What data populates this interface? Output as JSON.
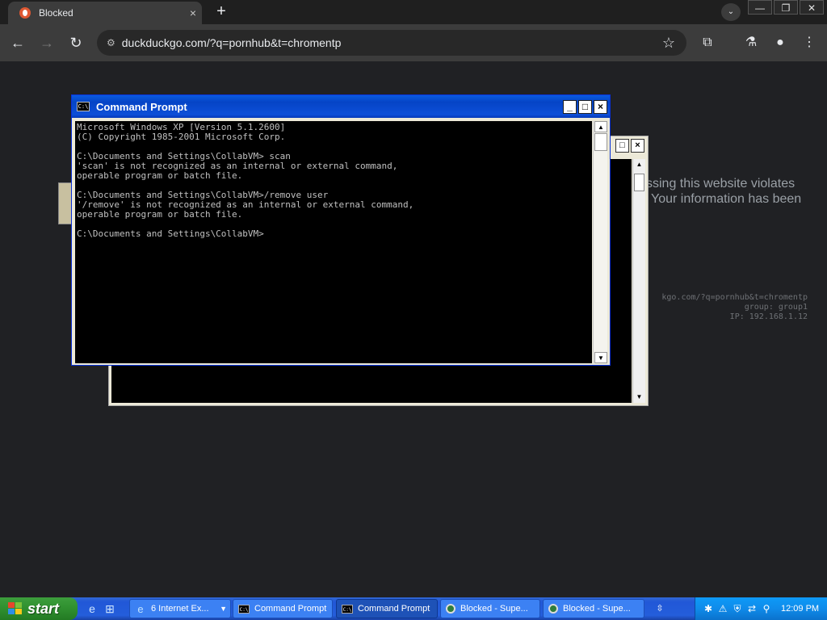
{
  "browser": {
    "tab_title": "Blocked",
    "tab_close": "×",
    "new_tab": "+",
    "tab_search": "⌄",
    "window_controls": [
      "—",
      "❐",
      "✕"
    ],
    "nav": {
      "back": "←",
      "forward": "→",
      "reload": "↻"
    },
    "url": "duckduckgo.com/?q=pornhub&t=chromentp",
    "bookmark": "☆",
    "extensions": "⧉",
    "labs": "⚗",
    "profile": "●",
    "menu": "⋮"
  },
  "page": {
    "blocked_line1": "ssing this website violates",
    "blocked_line2": "Your information has been",
    "meta_line1": "kgo.com/?q=pornhub&t=chromentp",
    "meta_line2": "group: group1",
    "meta_line3": "IP: 192.168.1.12"
  },
  "cmd_window": {
    "title": "Command Prompt",
    "icon": "C:\\",
    "controls": [
      "_",
      "□",
      "×"
    ],
    "console_lines": [
      "Microsoft Windows XP [Version 5.1.2600]",
      "(C) Copyright 1985-2001 Microsoft Corp.",
      "",
      "C:\\Documents and Settings\\CollabVM> scan",
      "'scan' is not recognized as an internal or external command,",
      "operable program or batch file.",
      "",
      "C:\\Documents and Settings\\CollabVM>/remove user",
      "'/remove' is not recognized as an internal or external command,",
      "operable program or batch file.",
      "",
      "C:\\Documents and Settings\\CollabVM>"
    ],
    "scroll_up": "▲",
    "scroll_down": "▼"
  },
  "back_window": {
    "controls": [
      "□",
      "×"
    ],
    "scroll_up": "▲",
    "scroll_down": "▼"
  },
  "taskbar": {
    "start_label": "start",
    "quick_launch": [
      "e",
      "⊞",
      "e"
    ],
    "buttons": [
      {
        "label": "6 Internet Ex...",
        "icon": "e",
        "dropdown": "▼"
      },
      {
        "label": "Command Prompt",
        "icon": "C:\\"
      },
      {
        "label": "Command Prompt",
        "icon": "C:\\"
      },
      {
        "label": "Blocked - Supe...",
        "icon": ""
      },
      {
        "label": "Blocked - Supe...",
        "icon": ""
      }
    ],
    "overflow": "⇳",
    "tray_icons": [
      "✱",
      "⚠",
      "⛨",
      "⇄",
      "⚲"
    ],
    "clock": "12:09 PM"
  },
  "colors": {
    "xp_title_blue": "#0a5be0",
    "taskbar_blue": "#245edb",
    "start_green": "#2f8f2f",
    "console_text": "#c0c0c0"
  }
}
